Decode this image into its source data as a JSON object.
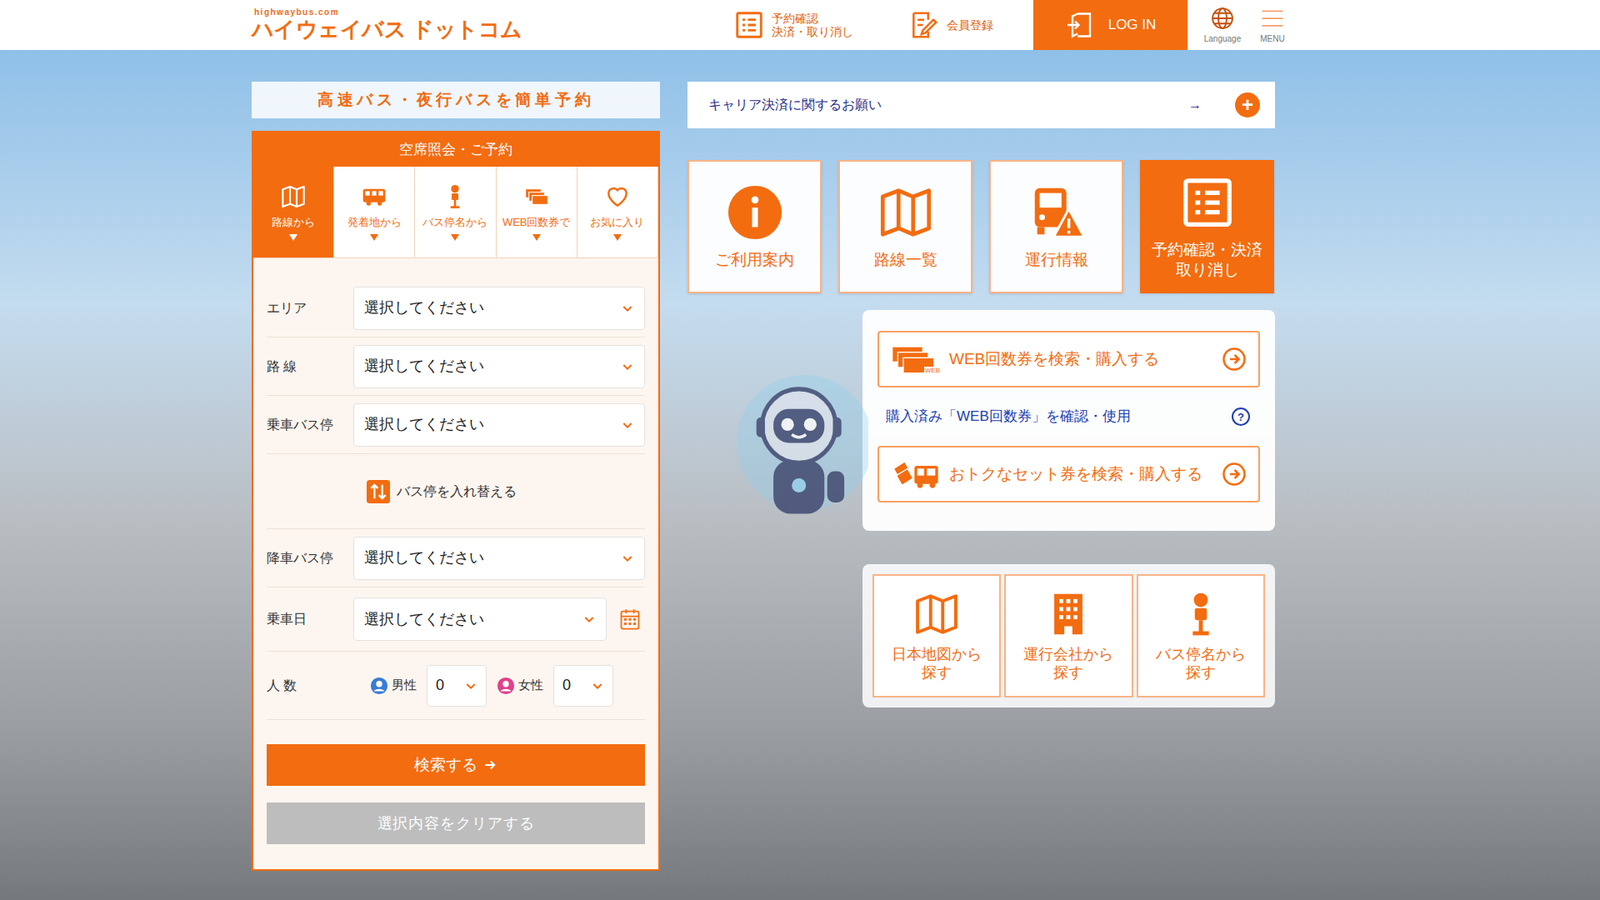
{
  "header": {
    "logo_small": "highwaybus.com",
    "logo": "ハイウェイバス ドットコム",
    "nav": [
      {
        "lines": [
          "予約確認",
          "決済・取り消し"
        ],
        "kind": "list"
      },
      {
        "lines": [
          "会員登録"
        ],
        "kind": "edit"
      }
    ],
    "login": "LOG IN",
    "language": "Language",
    "menu": "MENU"
  },
  "search_panel": {
    "banner": "高速バス・夜行バスを簡単予約",
    "title": "空席照会・ご予約",
    "tabs": [
      {
        "label": "路線から",
        "selected": true,
        "kind": "map"
      },
      {
        "label": "発着地から",
        "selected": false,
        "kind": "bus"
      },
      {
        "label": "バス停名から",
        "selected": false,
        "kind": "bus-stop"
      },
      {
        "label": "WEB回数券で",
        "selected": false,
        "kind": "ticket"
      },
      {
        "label": "お気に入り",
        "selected": false,
        "kind": "heart"
      }
    ],
    "fields": [
      {
        "label": "エリア",
        "value": "選択してください",
        "kind": "select"
      },
      {
        "label": "路 線",
        "value": "選択してください",
        "kind": "select"
      },
      {
        "label": "乗車バス停",
        "value": "選択してください",
        "kind": "select"
      },
      {
        "label": "降車バス停",
        "value": "選択してください",
        "kind": "select"
      },
      {
        "label": "乗車日",
        "value": "選択してください",
        "kind": "date"
      }
    ],
    "swap": "バス停を入れ替える",
    "people": {
      "label": "人 数",
      "male": {
        "label": "男性",
        "value": "0"
      },
      "female": {
        "label": "女性",
        "value": "0"
      }
    },
    "search_button": "検索する",
    "clear_button": {
      "label": "選択内容をクリアする",
      "disabled": true
    }
  },
  "notice": {
    "text": "キャリア決済に関するお願い",
    "arrow": "→",
    "plus": "+"
  },
  "tiles": [
    {
      "lines": [
        "ご利用案内"
      ],
      "highlighted": false,
      "kind": "info"
    },
    {
      "lines": [
        "路線一覧"
      ],
      "highlighted": false,
      "kind": "map"
    },
    {
      "lines": [
        "運行情報"
      ],
      "highlighted": false,
      "kind": "bus-alert"
    },
    {
      "lines": [
        "予約確認・決済",
        "取り消し"
      ],
      "highlighted": true,
      "kind": "list"
    }
  ],
  "tickets": {
    "buttons": [
      {
        "label": "WEB回数券を検索・購入する",
        "badge": "WEB",
        "kind": "web-ticket"
      },
      {
        "label": "おトクなセット券を検索・購入する",
        "badge": "",
        "kind": "set-ticket"
      }
    ],
    "link": "購入済み「WEB回数券」を確認・使用",
    "help": "?"
  },
  "search_by": [
    {
      "lines": [
        "日本地図から",
        "探す"
      ],
      "kind": "map"
    },
    {
      "lines": [
        "運行会社から",
        "探す"
      ],
      "kind": "building"
    },
    {
      "lines": [
        "バス停名から",
        "探す"
      ],
      "kind": "bus-stop"
    }
  ]
}
